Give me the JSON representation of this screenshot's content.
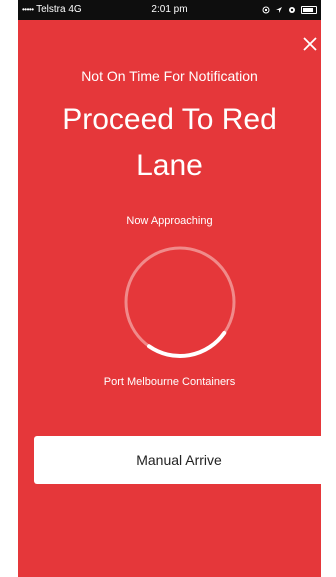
{
  "status_bar": {
    "signal": "•••••",
    "carrier": "Telstra",
    "network": "4G",
    "time": "2:01 pm",
    "icons": [
      "lock-rotation-icon",
      "location-arrow-icon",
      "alarm-icon",
      "battery-icon"
    ],
    "battery_level": 0.85
  },
  "header": {
    "close_icon": "close-icon",
    "subtitle": "Not On Time For Notification",
    "title": "Proceed To Red Lane"
  },
  "main": {
    "approaching_label": "Now Approaching",
    "progress_value": 0.25,
    "destination": "Port Melbourne Containers",
    "manual_arrive_label": "Manual Arrive"
  },
  "colors": {
    "background": "#e5373a",
    "ring_track": "#f08a8a",
    "ring_progress": "#ffffff",
    "button": "#ffffff"
  }
}
